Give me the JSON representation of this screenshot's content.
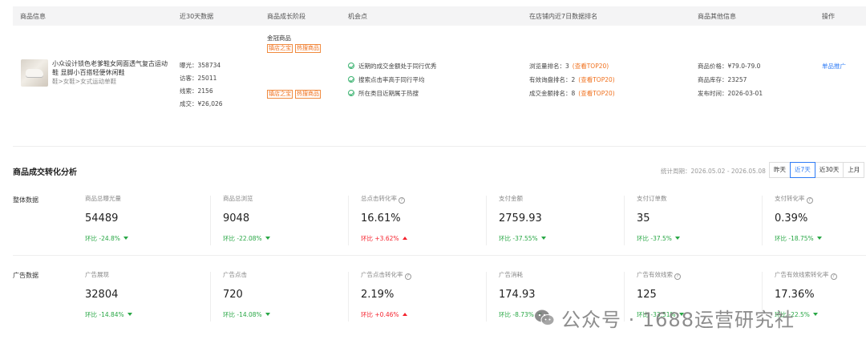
{
  "table": {
    "headers": [
      "商品信息",
      "近30天数据",
      "商品成长阶段",
      "机会点",
      "在店铺内近7日数据排名",
      "商品其他信息",
      "操作"
    ],
    "product": {
      "name": "小众设计锁色老爹鞋女网面透气复古运动鞋 显脚小百搭轻便休闲鞋",
      "category": "鞋>女鞋>女式运动单鞋"
    },
    "d30": [
      "曝光：358734",
      "访客：25011",
      "线索：2156",
      "成交：¥26,026"
    ],
    "stage": {
      "title": "金冠商品",
      "tags_top": [
        "镇店之宝",
        "热搜商品"
      ],
      "tags_bottom": [
        "镇店之宝",
        "热搜商品"
      ]
    },
    "opportunities": [
      "近期的成交金额处于同行优秀",
      "搜索点击率高于同行平均",
      "所在类目近期属于热搜"
    ],
    "ranks": [
      {
        "label": "浏览量排名：3",
        "link": "(查看TOP20)"
      },
      {
        "label": "有效询盘排名：2",
        "link": "(查看TOP20)"
      },
      {
        "label": "成交金额排名：8",
        "link": "(查看TOP20)"
      }
    ],
    "other": [
      "商品价格：¥79.0-79.0",
      "商品库存：23257",
      "发布时间：2026-03-01"
    ],
    "action": "单品推广"
  },
  "analysis": {
    "title": "商品成交转化分析",
    "period": "统计周期：2026.05.02 - 2026.05.08",
    "ranges": [
      "昨天",
      "近7天",
      "近30天",
      "上月"
    ],
    "active_range": "近7天",
    "overall": {
      "label": "整体数据",
      "metrics": [
        {
          "label": "商品总曝光量",
          "value": "54489",
          "change": "环比 -24.8%",
          "dir": "down",
          "help": false
        },
        {
          "label": "商品总浏览",
          "value": "9048",
          "change": "环比 -22.08%",
          "dir": "down",
          "help": false
        },
        {
          "label": "总点击转化率",
          "value": "16.61%",
          "change": "环比 +3.62%",
          "dir": "up",
          "help": true
        },
        {
          "label": "支付金额",
          "value": "2759.93",
          "change": "环比 -37.55%",
          "dir": "down",
          "help": false
        },
        {
          "label": "支付订单数",
          "value": "35",
          "change": "环比 -37.5%",
          "dir": "down",
          "help": false
        },
        {
          "label": "支付转化率",
          "value": "0.39%",
          "change": "环比 -18.75%",
          "dir": "down",
          "help": true
        }
      ]
    },
    "ads": {
      "label": "广告数据",
      "metrics": [
        {
          "label": "广告展现",
          "value": "32804",
          "change": "环比 -14.84%",
          "dir": "down",
          "help": false
        },
        {
          "label": "广告点击",
          "value": "720",
          "change": "环比 -14.08%",
          "dir": "down",
          "help": false
        },
        {
          "label": "广告点击转化率",
          "value": "2.19%",
          "change": "环比 +0.46%",
          "dir": "up",
          "help": true
        },
        {
          "label": "广告消耗",
          "value": "174.93",
          "change": "环比 -8.73%",
          "dir": "down",
          "help": false
        },
        {
          "label": "广告有效线索",
          "value": "125",
          "change": "环比 -33.51%",
          "dir": "down",
          "help": true
        },
        {
          "label": "广告有效线索转化率",
          "value": "17.36%",
          "change": "环比 -22.5%",
          "dir": "down",
          "help": true
        }
      ]
    }
  },
  "watermark": "公众号 · 1688运营研究社",
  "colors": {
    "accent": "#2f7cf6",
    "tag": "#f0711e",
    "down": "#28a745",
    "up": "#f5222d"
  }
}
